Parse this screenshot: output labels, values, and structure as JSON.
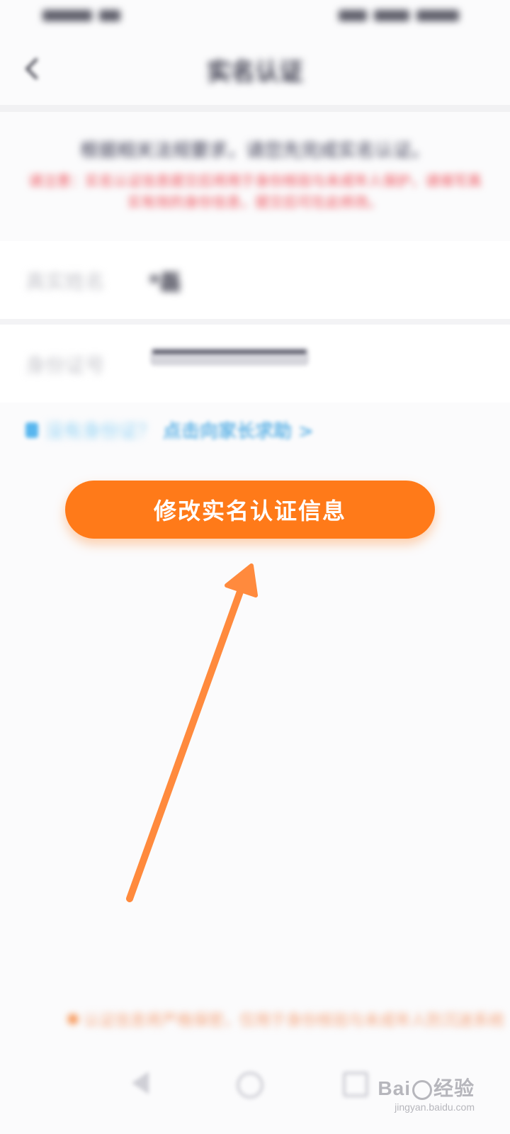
{
  "status_bar": {
    "left_blocks": 2,
    "right_blocks": 3
  },
  "header": {
    "back_icon": "chevron-left-icon",
    "title": "实名认证"
  },
  "notice": {
    "main": "根据相关法规要求，请您先完成实名认证。",
    "warning": "请注意：实名认证信息提交后将用于身份核验与未成年人保护，请填写真实有效的身份信息，提交后可在此修改。"
  },
  "form": {
    "name_label": "真实姓名",
    "name_value": "*磊",
    "id_label": "身份证号"
  },
  "help": {
    "icon": "id-card-icon",
    "prefix": "没有身份证？",
    "action": "点击向家长求助 >"
  },
  "primary_button": {
    "label": "修改实名认证信息"
  },
  "bottom_note": {
    "text": "认证信息将严格保密，仅用于身份核验与未成年人防沉迷系统"
  },
  "watermark": {
    "brand_left": "Bai",
    "brand_right": "经验",
    "url": "jingyan.baidu.com"
  },
  "colors": {
    "accent": "#ff7a19",
    "link": "#62b4e6",
    "warning": "#ef4c55",
    "arrow": "#ff8a3d"
  }
}
